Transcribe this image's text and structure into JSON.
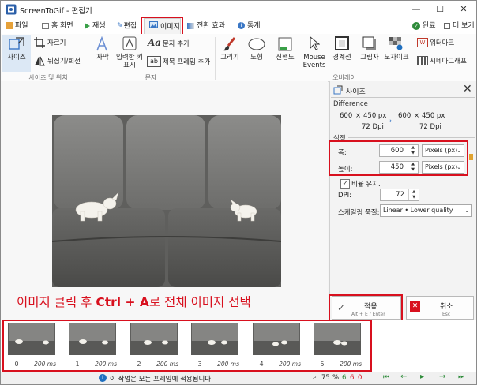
{
  "window": {
    "title": "ScreenToGif - 편집기"
  },
  "window_controls": {
    "minimize": "—",
    "maximize": "☐",
    "close": "✕"
  },
  "tabs": [
    {
      "label": "파일"
    },
    {
      "label": "홈 화면"
    },
    {
      "label": "재생"
    },
    {
      "label": "편집"
    },
    {
      "label": "이미지"
    },
    {
      "label": "전환 효과"
    },
    {
      "label": "통계"
    }
  ],
  "tabbar_right": {
    "done": "완료",
    "more": "더 보기"
  },
  "ribbon": {
    "size_position": {
      "resize": "사이즈",
      "crop": "자르기",
      "flip_rotate": "뒤집기/회전",
      "group": "사이즈 및 위치"
    },
    "text": {
      "caption": "자막",
      "key_strokes": "입력한 키 표시",
      "free_text": "문자 추가",
      "title_frame": "제목 프레임 추가",
      "group": "문자"
    },
    "overlay": {
      "free_drawing": "그리기",
      "shapes": "도형",
      "progress": "진행도",
      "mouse_events": "Mouse Events",
      "border": "경계선",
      "shadow": "그림자",
      "obfuscate": "모자이크",
      "watermark": "워터마크",
      "cinemagraph": "시네마그래프",
      "group": "오버레이"
    }
  },
  "panel": {
    "title": "사이즈",
    "difference_label": "Difference",
    "orig_w": "600",
    "orig_x": "×",
    "orig_h": "450 px",
    "arrow": "→",
    "new_w": "600",
    "new_x": "×",
    "new_h": "450 px",
    "orig_dpi": "72 Dpi",
    "new_dpi": "72 Dpi",
    "settings_label": "설정",
    "width_label": "폭:",
    "width_value": "600",
    "width_unit": "Pixels (px)",
    "height_label": "높이:",
    "height_value": "450",
    "height_unit": "Pixels (px)",
    "keep_ratio": "비율 유지.",
    "dpi_label": "DPI:",
    "dpi_value": "72",
    "scaling_label": "스케일링 품질:",
    "scaling_value": "Linear • Lower quality",
    "apply": "적용",
    "apply_shortcut": "Alt + E / Enter",
    "cancel": "취소",
    "cancel_shortcut": "Esc"
  },
  "instruction": {
    "pre": "이미지 클릭 후 ",
    "key1": "Ctrl",
    "plus": " + ",
    "key2": "A",
    "post": "로 전체 이미지 선택"
  },
  "frames": [
    {
      "index": "0",
      "delay": "200 ms"
    },
    {
      "index": "1",
      "delay": "200 ms"
    },
    {
      "index": "2",
      "delay": "200 ms"
    },
    {
      "index": "3",
      "delay": "200 ms"
    },
    {
      "index": "4",
      "delay": "200 ms"
    },
    {
      "index": "5",
      "delay": "200 ms"
    }
  ],
  "status": {
    "message": "이 작업은 모든 프레임에 적용됩니다",
    "zoom": "75",
    "zoom_unit": "%",
    "selected": "6",
    "current": "6",
    "total": "0"
  },
  "colors": {
    "accent_red": "#d8101e",
    "accent_blue": "#1e6fbf",
    "green": "#2e8b3a"
  }
}
